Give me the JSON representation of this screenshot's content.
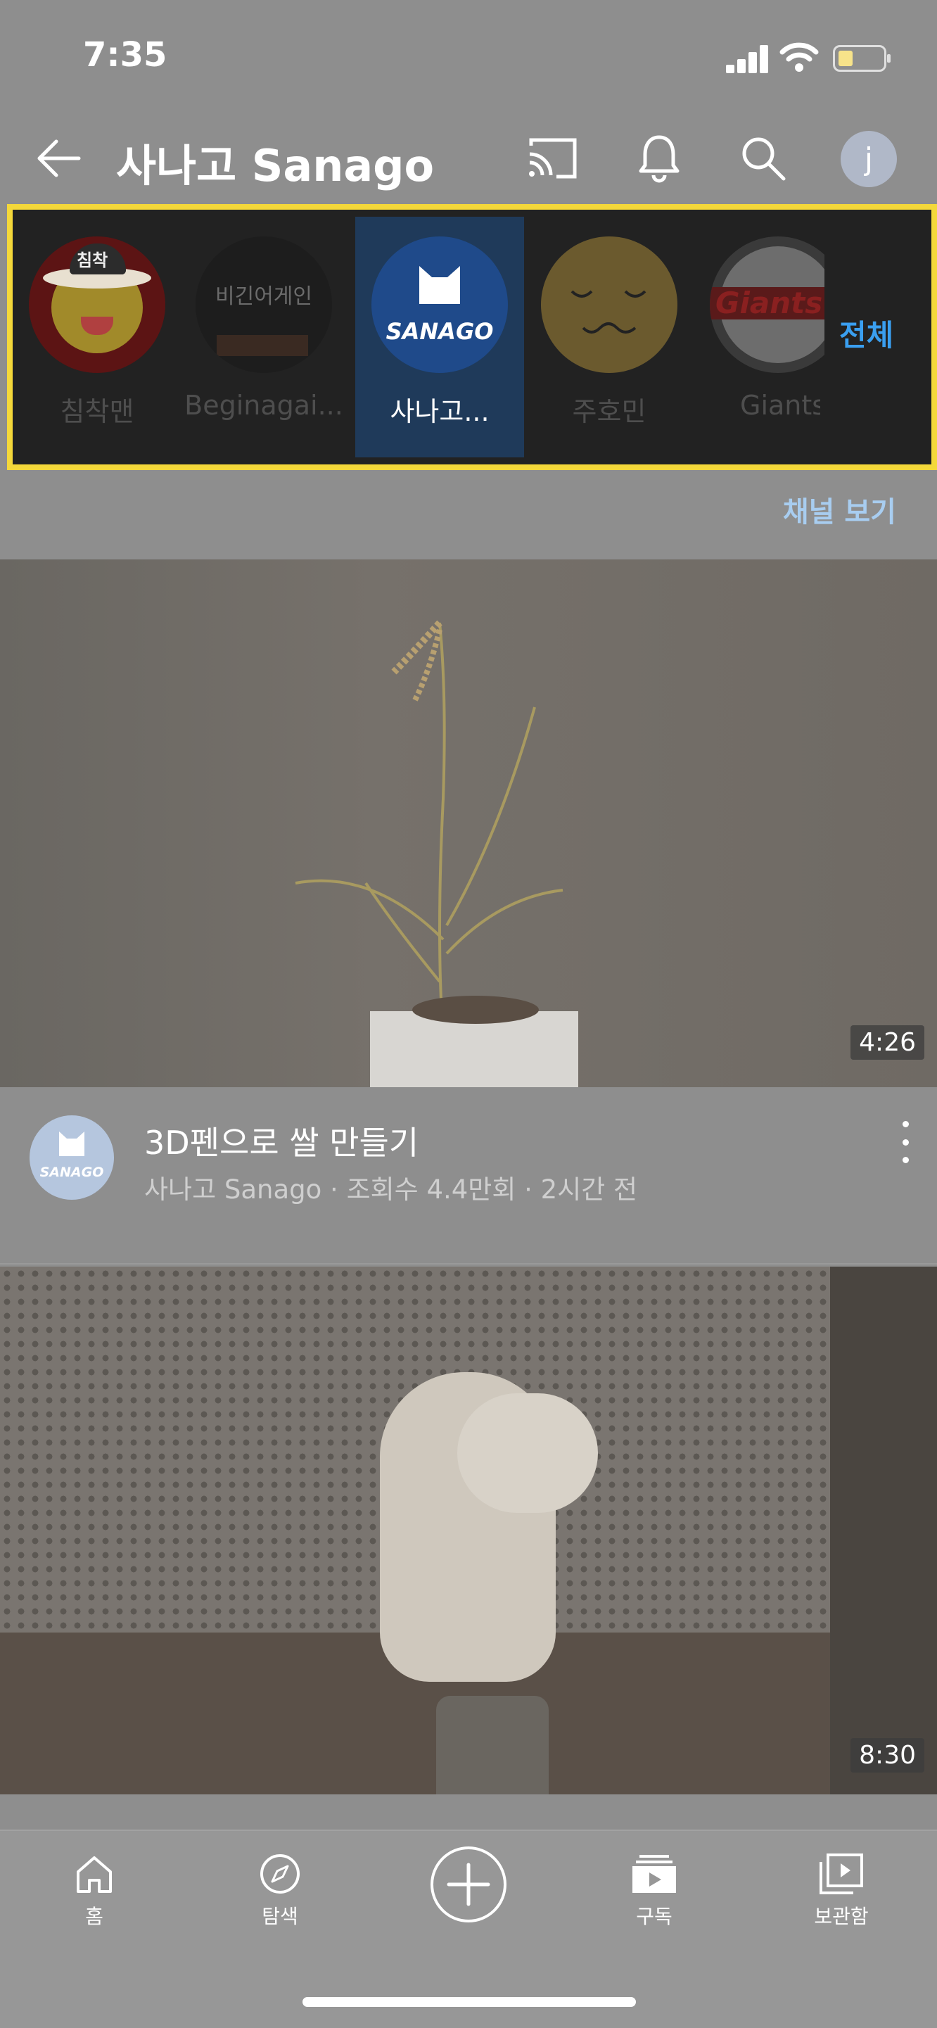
{
  "status_bar": {
    "time": "7:35"
  },
  "header": {
    "title": "사나고 Sanago",
    "avatar_letter": "j"
  },
  "subscriptions": {
    "channels": [
      {
        "name": "침착맨",
        "active": false
      },
      {
        "name": "Beginagai...",
        "active": false
      },
      {
        "name": "사나고...",
        "active": true,
        "logo_text": "SANAGO"
      },
      {
        "name": "주호민",
        "active": false
      },
      {
        "name": "Giants",
        "active": false,
        "logo_text": "Giants"
      }
    ],
    "all_label": "전체",
    "avatar_text_1": "침착",
    "avatar_text_2": "비긴어게인"
  },
  "channel_view_label": "채널 보기",
  "videos": [
    {
      "title": "3D펜으로 쌀 만들기",
      "meta": "사나고 Sanago · 조회수 4.4만회 · 2시간 전",
      "duration": "4:26",
      "channel_logo": "SANAGO"
    },
    {
      "title": "",
      "meta": "",
      "duration": "8:30"
    }
  ],
  "bottom_nav": [
    {
      "label": "홈",
      "icon": "home-icon"
    },
    {
      "label": "탐색",
      "icon": "compass-icon"
    },
    {
      "label": "",
      "icon": "add-icon"
    },
    {
      "label": "구독",
      "icon": "subscriptions-icon"
    },
    {
      "label": "보관함",
      "icon": "library-icon"
    }
  ],
  "colors": {
    "highlight_border": "#f4d83a",
    "link_blue": "#3a9ff0"
  }
}
